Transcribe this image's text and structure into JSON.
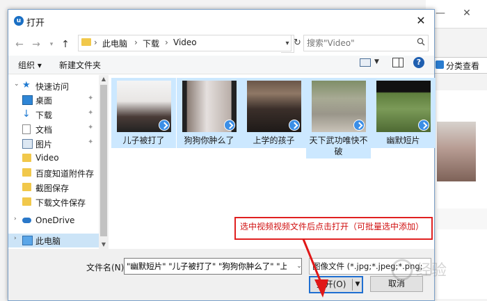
{
  "background_app": {
    "window_controls": [
      "—",
      "✕"
    ],
    "classify_button": "分类查看"
  },
  "dialog": {
    "title": "打开",
    "close": "✕"
  },
  "address": {
    "breadcrumbs": [
      "此电脑",
      "下载",
      "Video"
    ],
    "separator": "›",
    "search_placeholder": "搜索\"Video\""
  },
  "toolbar": {
    "organize": "组织 ▾",
    "new_folder": "新建文件夹",
    "help": "?"
  },
  "nav": {
    "items": [
      {
        "label": "快速访问",
        "icon": "star-icon",
        "pinned": false
      },
      {
        "label": "桌面",
        "icon": "desktop-icon",
        "pinned": true
      },
      {
        "label": "下载",
        "icon": "download-icon",
        "pinned": true
      },
      {
        "label": "文档",
        "icon": "document-icon",
        "pinned": true
      },
      {
        "label": "图片",
        "icon": "picture-icon",
        "pinned": true
      },
      {
        "label": "Video",
        "icon": "folder-icon",
        "pinned": false
      },
      {
        "label": "百度知道附件存",
        "icon": "folder-icon",
        "pinned": false
      },
      {
        "label": "截图保存",
        "icon": "folder-icon",
        "pinned": false
      },
      {
        "label": "下载文件保存",
        "icon": "folder-icon",
        "pinned": false
      },
      {
        "label": "OneDrive",
        "icon": "cloud-icon",
        "pinned": false
      },
      {
        "label": "此电脑",
        "icon": "computer-icon",
        "pinned": false
      }
    ],
    "pin_glyph": "📌"
  },
  "files": [
    {
      "name": "儿子被打了",
      "selected": true
    },
    {
      "name": "狗狗你肿么了",
      "selected": true
    },
    {
      "name": "上学的孩子",
      "selected": true
    },
    {
      "name": "天下武功唯快不破",
      "selected": true
    },
    {
      "name": "幽默短片",
      "selected": true
    }
  ],
  "annotation": "选中视频视频文件后点击打开（可批量选中添加）",
  "bottom": {
    "filename_label": "文件名(N):",
    "filename_value": "\"幽默短片\" \"儿子被打了\" \"狗狗你肿么了\" \"上学的孩",
    "filetype_value": "图像文件 (*.jpg;*.jpeg;*.png;",
    "open_button": "打开(O)",
    "cancel_button": "取消"
  },
  "watermark": "经验"
}
